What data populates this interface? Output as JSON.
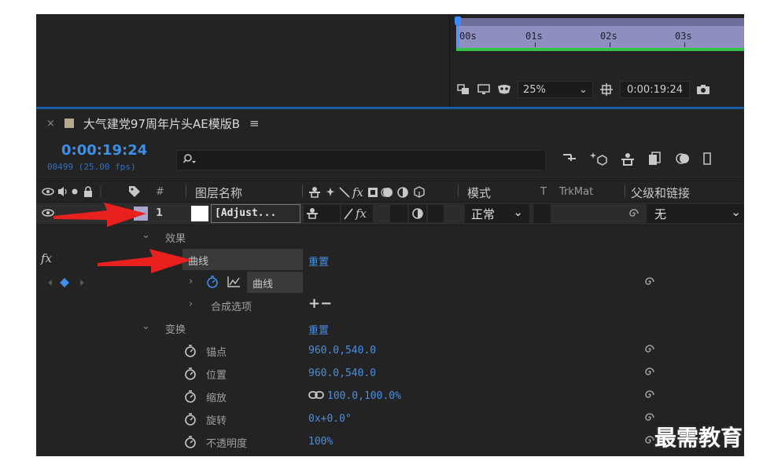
{
  "timeline_ruler": {
    "ticks": [
      "00s",
      "01s",
      "02s",
      "03s"
    ]
  },
  "viewer_toolbar": {
    "zoom": "25%",
    "timecode": "0:00:19:24"
  },
  "comp_tab": {
    "title": "大气建党97周年片头AE模版B",
    "close_glyph": "×",
    "menu_glyph": "≡"
  },
  "comp_header": {
    "current_time": "0:00:19:24",
    "frame_info": "00499 (25.00 fps)",
    "search_placeholder": ""
  },
  "columns": {
    "hash": "#",
    "layer_name": "图层名称",
    "mode": "模式",
    "t": "T",
    "trkmat": "TrkMat",
    "parent": "父级和链接"
  },
  "layer": {
    "number": "1",
    "name": "[Adjust...",
    "mode": "正常",
    "parent": "无"
  },
  "tree": {
    "effects": "效果",
    "fx": "fx",
    "curves_effect": "曲线",
    "reset_1": "重置",
    "curves_prop": "曲线",
    "compositing_options": "合成选项",
    "plus_minus": "+−",
    "transform": "变换",
    "reset_2": "重置",
    "anchor_point": {
      "label": "锚点",
      "value": "960.0,540.0"
    },
    "position": {
      "label": "位置",
      "value": "960.0,540.0"
    },
    "scale": {
      "label": "缩放",
      "value": "100.0,100.0%"
    },
    "rotation": {
      "label": "旋转",
      "value": "0x+0.0°"
    },
    "opacity": {
      "label": "不透明度",
      "value": "100%"
    }
  },
  "watermark": "最需教育",
  "colors": {
    "panel_bg": "#232323",
    "accent_blue": "#3f8fe8",
    "label_lavender": "#a8a6cc",
    "ruler_purple": "#8e8fbf",
    "annotation_red": "#e8201e"
  }
}
